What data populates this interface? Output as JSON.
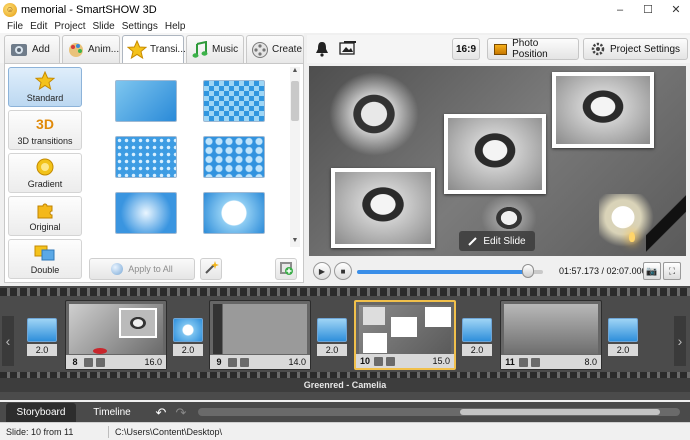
{
  "window": {
    "title": "memorial - SmartSHOW 3D",
    "minimize": "–",
    "maximize": "☐",
    "close": "✕"
  },
  "menu": [
    "File",
    "Edit",
    "Project",
    "Slide",
    "Settings",
    "Help"
  ],
  "tabs": [
    {
      "label": "Add",
      "icon": "add-photo-icon"
    },
    {
      "label": "Anim...",
      "icon": "animation-palette-icon"
    },
    {
      "label": "Transi...",
      "icon": "star-icon"
    },
    {
      "label": "Music",
      "icon": "music-note-icon"
    },
    {
      "label": "Create",
      "icon": "film-reel-icon"
    }
  ],
  "categories": [
    {
      "label": "Standard",
      "icon": "star-icon"
    },
    {
      "label": "3D transitions",
      "icon": "3d-text-icon",
      "badge": "3D"
    },
    {
      "label": "Gradient",
      "icon": "gradient-icon"
    },
    {
      "label": "Original",
      "icon": "puzzle-icon"
    },
    {
      "label": "Double",
      "icon": "double-icon"
    }
  ],
  "transitions_panel": {
    "apply_all_label": "Apply to All",
    "scroll_up": "▲",
    "scroll_down": "▼"
  },
  "toolbar_right": {
    "aspect_label": "16:9",
    "photo_position_label": "Photo Position",
    "project_settings_label": "Project Settings"
  },
  "preview": {
    "edit_slide_label": "Edit Slide"
  },
  "player": {
    "play_label": "▶",
    "stop_label": "■",
    "timecode": "01:57.173 / 02:07.000",
    "snapshot_label": "📷",
    "fullscreen_label": "⛶",
    "progress_fraction": 0.92
  },
  "storyboard": {
    "left_arrow": "‹",
    "right_arrow": "›",
    "slides": [
      {
        "number": "8",
        "duration": "16.0"
      },
      {
        "number": "9",
        "duration": "14.0"
      },
      {
        "number": "10",
        "duration": "15.0"
      },
      {
        "number": "11",
        "duration": "8.0"
      }
    ],
    "transitions": [
      "2.0",
      "2.0",
      "2.0",
      "2.0",
      "2.0"
    ],
    "audio_track": "Greenred - Camelia"
  },
  "bottom_tabs": {
    "storyboard_label": "Storyboard",
    "timeline_label": "Timeline",
    "undo": "↶",
    "redo": "↷"
  },
  "status": {
    "slide_info": "Slide: 10 from 11",
    "path": "C:\\Users\\Content\\Desktop\\"
  },
  "colors": {
    "accent_blue": "#3a8ee8",
    "selected_border": "#f1c04b",
    "storyboard_bg": "#4b4b4b"
  }
}
